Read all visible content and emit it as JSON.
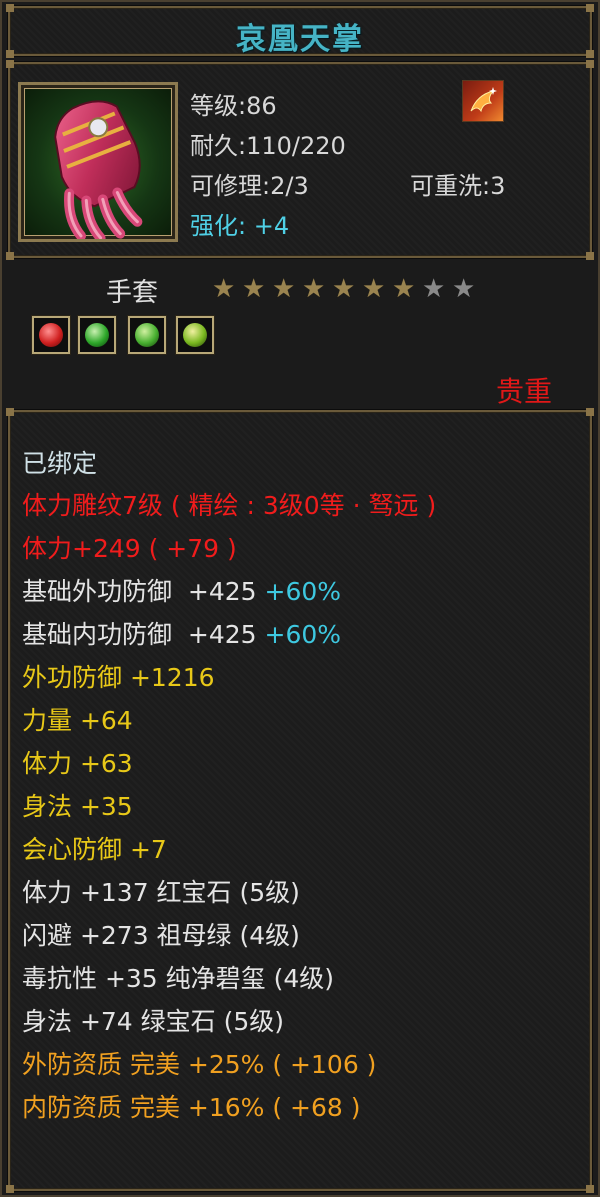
{
  "title": "哀凰天掌",
  "item": {
    "icon": "red-gauntlet-icon",
    "level": "等级:86",
    "durability": "耐久:110/220",
    "repair": "可修理:2/3",
    "reroll": "可重洗:3",
    "enhance": "强化: +4",
    "buff_icon": "phoenix-buff-icon"
  },
  "type_label": "手套",
  "stars": {
    "filled": 7,
    "total": 9
  },
  "gems": [
    {
      "icon": "red-gem-icon",
      "color": "#d02020"
    },
    {
      "icon": "green-gem-icon",
      "color": "#2ea82a"
    },
    {
      "icon": "green-gem-icon",
      "color": "#48b030"
    },
    {
      "icon": "jade-gem-icon",
      "color": "#7ab820"
    }
  ],
  "rarity": "贵重",
  "attributes": {
    "bound": "已绑定",
    "engrave": "体力雕纹7级 ( 精绘 : 3级0等 · 驽远 )",
    "stamina_main": "体力+249 ( +79 )",
    "base_outer_def": {
      "label": "基础外功防御  +425 ",
      "pct": "+60%"
    },
    "base_inner_def": {
      "label": "基础内功防御  +425 ",
      "pct": "+60%"
    },
    "outer_def": "外功防御  +1216",
    "strength": "力量  +64",
    "stamina": "体力  +63",
    "agility": "身法  +35",
    "crit_def": "会心防御  +7",
    "gem_lines": [
      "体力  +137  红宝石 (5级)",
      "闪避  +273  祖母绿 (4级)",
      "毒抗性  +35  纯净碧玺 (4级)",
      "身法  +74  绿宝石 (5级)"
    ],
    "quality": [
      "外防资质    完美  +25%  ( +106 )",
      "内防资质    完美  +16%  ( +68 )"
    ]
  },
  "colors": {
    "title": "#46b4c6",
    "red": "#f01c1c",
    "yellow": "#e8c818",
    "cyan": "#3ec8e0",
    "orange": "#f0a020"
  }
}
